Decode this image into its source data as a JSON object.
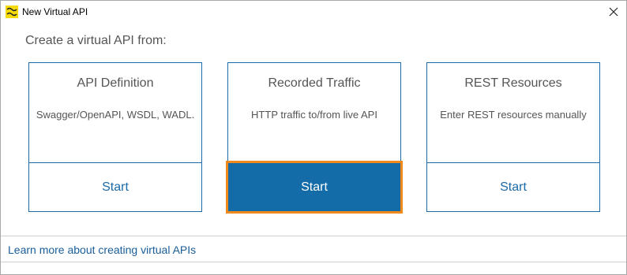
{
  "window": {
    "title": "New Virtual API",
    "close_label": "✕"
  },
  "heading": "Create a virtual API from:",
  "cards": [
    {
      "title": "API Definition",
      "description": "Swagger/OpenAPI, WSDL, WADL.",
      "start_label": "Start"
    },
    {
      "title": "Recorded Traffic",
      "description": "HTTP traffic to/from live API",
      "start_label": "Start"
    },
    {
      "title": "REST Resources",
      "description": "Enter REST resources manually",
      "start_label": "Start"
    }
  ],
  "footer": {
    "link_text": "Learn more about creating virtual APIs"
  },
  "colors": {
    "accent": "#136ba8",
    "focus_border": "#f08a1c",
    "link": "#1a5e9a"
  }
}
